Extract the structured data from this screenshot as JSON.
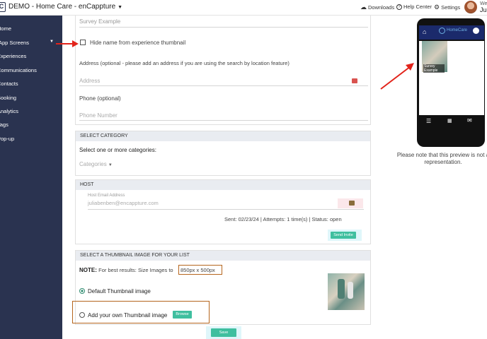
{
  "topbar": {
    "app_title": "DEMO - Home Care - enCappture",
    "downloads": "Downloads",
    "help_center": "Help Center",
    "settings": "Settings",
    "welcome": "We",
    "user": "Ju"
  },
  "sidebar": {
    "items": [
      {
        "label": "Home"
      },
      {
        "label": "App Screens"
      },
      {
        "label": "Experiences"
      },
      {
        "label": "Communications"
      },
      {
        "label": "Contacts"
      },
      {
        "label": "Booking"
      },
      {
        "label": "Analytics"
      },
      {
        "label": "Tags"
      },
      {
        "label": "Pop-up"
      }
    ]
  },
  "form": {
    "survey_example": "Survey Example",
    "hide_name_label": "Hide name from experience thumbnail",
    "address_label": "Address (optional - please add an address if you are using the search by location feature)",
    "address_placeholder": "Address",
    "phone_label": "Phone (optional)",
    "phone_placeholder": "Phone Number",
    "category_header": "SELECT CATEGORY",
    "category_instruction": "Select one or more categories:",
    "categories_dropdown": "Categories",
    "host_header": "HOST",
    "host_email_label": "Host Email Address",
    "host_email_value": "juliabenben@encappture.com",
    "sent_info": "Sent: 02/23/24  |  Attempts: 1 time(s)  |  Status: open",
    "send_invite": "Send Invite",
    "thumbnail_header": "SELECT A THUMBNAIL IMAGE FOR YOUR LIST",
    "note_bold": "NOTE:",
    "note_text": "For best results: Size Images to",
    "note_size": "850px x 500px",
    "default_thumb": "Default Thumbnail image",
    "own_thumb": "Add your own Thumbnail image",
    "browse": "Browse",
    "save": "Save"
  },
  "preview": {
    "brand": "HomeCare",
    "thumb_caption": "Survey Example",
    "note": "Please note that this preview is not a representation."
  }
}
